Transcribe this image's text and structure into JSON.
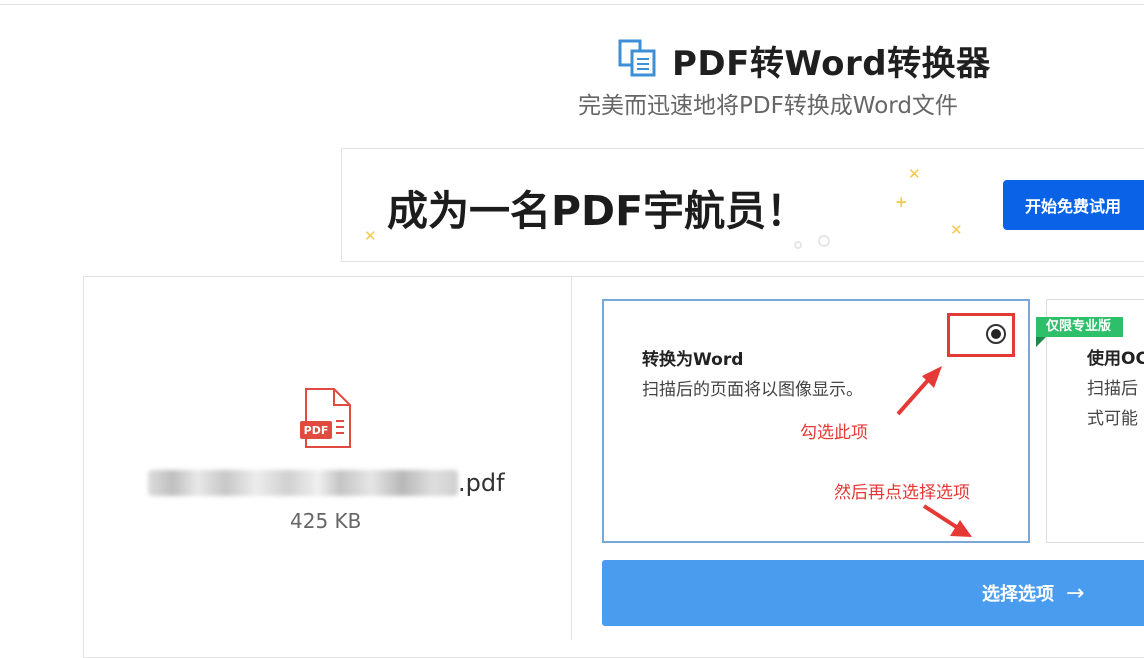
{
  "header": {
    "title": "PDF转Word转换器",
    "subtitle": "完美而迅速地将PDF转换成Word文件"
  },
  "banner": {
    "headline": "成为一名PDF宇航员！",
    "cta_label": "开始免费试用"
  },
  "file": {
    "icon_label": "PDF",
    "name_suffix": ".pdf",
    "size": "425 KB"
  },
  "options": [
    {
      "title": "转换为Word",
      "description": "扫描后的页面将以图像显示。",
      "selected": true
    },
    {
      "badge": "仅限专业版",
      "title": "使用OC",
      "description_line1": "扫描后",
      "description_line2": "式可能"
    }
  ],
  "annotations": {
    "check_hint": "勾选此项",
    "next_hint": "然后再点选择选项"
  },
  "actions": {
    "select_label": "选择选项",
    "select_arrow": "→"
  },
  "colors": {
    "primary_button": "#0a63e6",
    "select_button": "#4a9cee",
    "annotation_red": "#e53935",
    "pro_badge": "#2ebf6b",
    "card_border": "#7aa8d6"
  }
}
